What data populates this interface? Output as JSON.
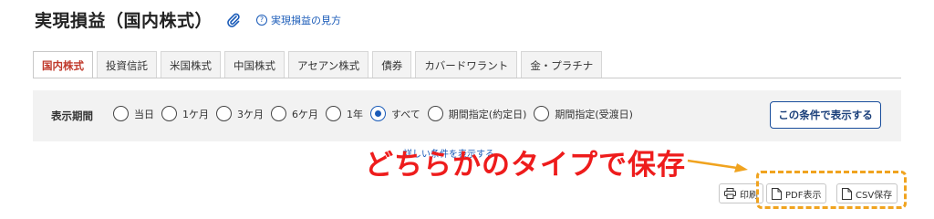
{
  "header": {
    "title": "実現損益（国内株式）",
    "clip_icon": "paperclip-icon",
    "help_link": "実現損益の見方",
    "help_icon": "question-circle-icon"
  },
  "tabs": [
    {
      "label": "国内株式",
      "active": true
    },
    {
      "label": "投資信託",
      "active": false
    },
    {
      "label": "米国株式",
      "active": false
    },
    {
      "label": "中国株式",
      "active": false
    },
    {
      "label": "アセアン株式",
      "active": false
    },
    {
      "label": "債券",
      "active": false
    },
    {
      "label": "カバードワラント",
      "active": false
    },
    {
      "label": "金・プラチナ",
      "active": false
    }
  ],
  "filter": {
    "label": "表示期間",
    "options": [
      {
        "label": "当日",
        "checked": false
      },
      {
        "label": "1ケ月",
        "checked": false
      },
      {
        "label": "3ケ月",
        "checked": false
      },
      {
        "label": "6ケ月",
        "checked": false
      },
      {
        "label": "1年",
        "checked": false
      },
      {
        "label": "すべて",
        "checked": true
      },
      {
        "label": "期間指定(約定日)",
        "checked": false
      },
      {
        "label": "期間指定(受渡日)",
        "checked": false
      }
    ],
    "apply_button": "この条件で表示する"
  },
  "details_link": "詳しい条件を表示する",
  "annotation": {
    "text": "どちらかのタイプで保存",
    "color": "#ee1c1c",
    "highlight_color": "#f0a31f"
  },
  "actions": {
    "print": "印刷",
    "pdf": "PDF表示",
    "csv": "CSV保存"
  },
  "colors": {
    "accent": "#1a5bb8",
    "active_tab": "#c0392b"
  }
}
